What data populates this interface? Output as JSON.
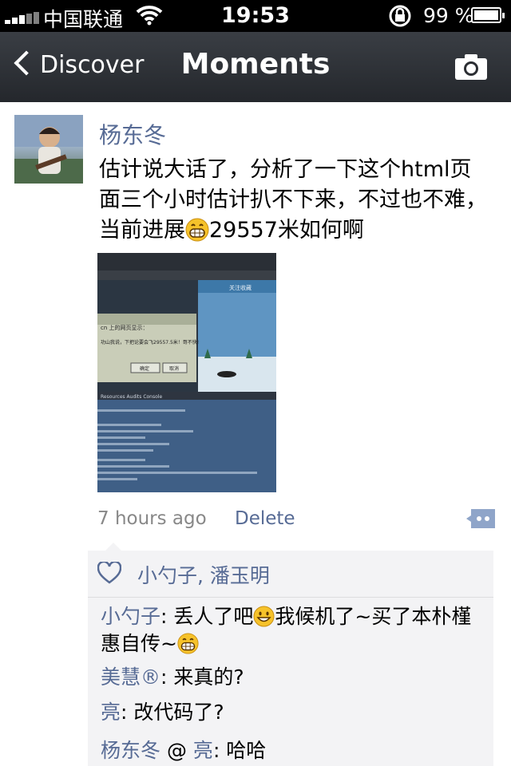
{
  "status_bar": {
    "carrier": "中国联通",
    "time": "19:53",
    "battery": "99 %",
    "icons": [
      "signal-icon",
      "wifi-icon",
      "rotation-lock-icon",
      "battery-icon"
    ]
  },
  "nav": {
    "back_label": "Discover",
    "title": "Moments",
    "right_icon": "camera-icon"
  },
  "post": {
    "author": "杨东冬",
    "text_before_emoji": "估计说大话了，分析了一下这个html页面三个小时估计扒不下来，不过也不难，当前进展",
    "text_after_emoji": "29557米如何啊",
    "time_ago": "7 hours ago",
    "delete_label": "Delete",
    "photo": {
      "dialog_title": "cn 上的网页显示：",
      "dialog_message": "功山我说，下把论要会飞29557.5米！哥不快!",
      "dialog_ok": "确定",
      "dialog_cancel": "取消",
      "banner": "关注收藏",
      "devtools_tabs": "Resources  Audits  Console"
    }
  },
  "likes": {
    "names": "小勺子, 潘玉明"
  },
  "comments": [
    {
      "author": "小勺子",
      "before_emoji": ": 丢人了吧",
      "after_emoji": "我候机了~买了本朴槿惠自传~"
    },
    {
      "author": "美慧®",
      "text": ": 来真的?"
    },
    {
      "author": "亮",
      "text": ": 改代码了?"
    },
    {
      "author": "杨东冬",
      "reply_sep": " @ ",
      "reply_to": "亮",
      "text": ": 哈哈"
    }
  ],
  "colors": {
    "link": "#576b95",
    "nav_bg": "#2b2e33",
    "comment_bg": "#f3f3f5"
  }
}
